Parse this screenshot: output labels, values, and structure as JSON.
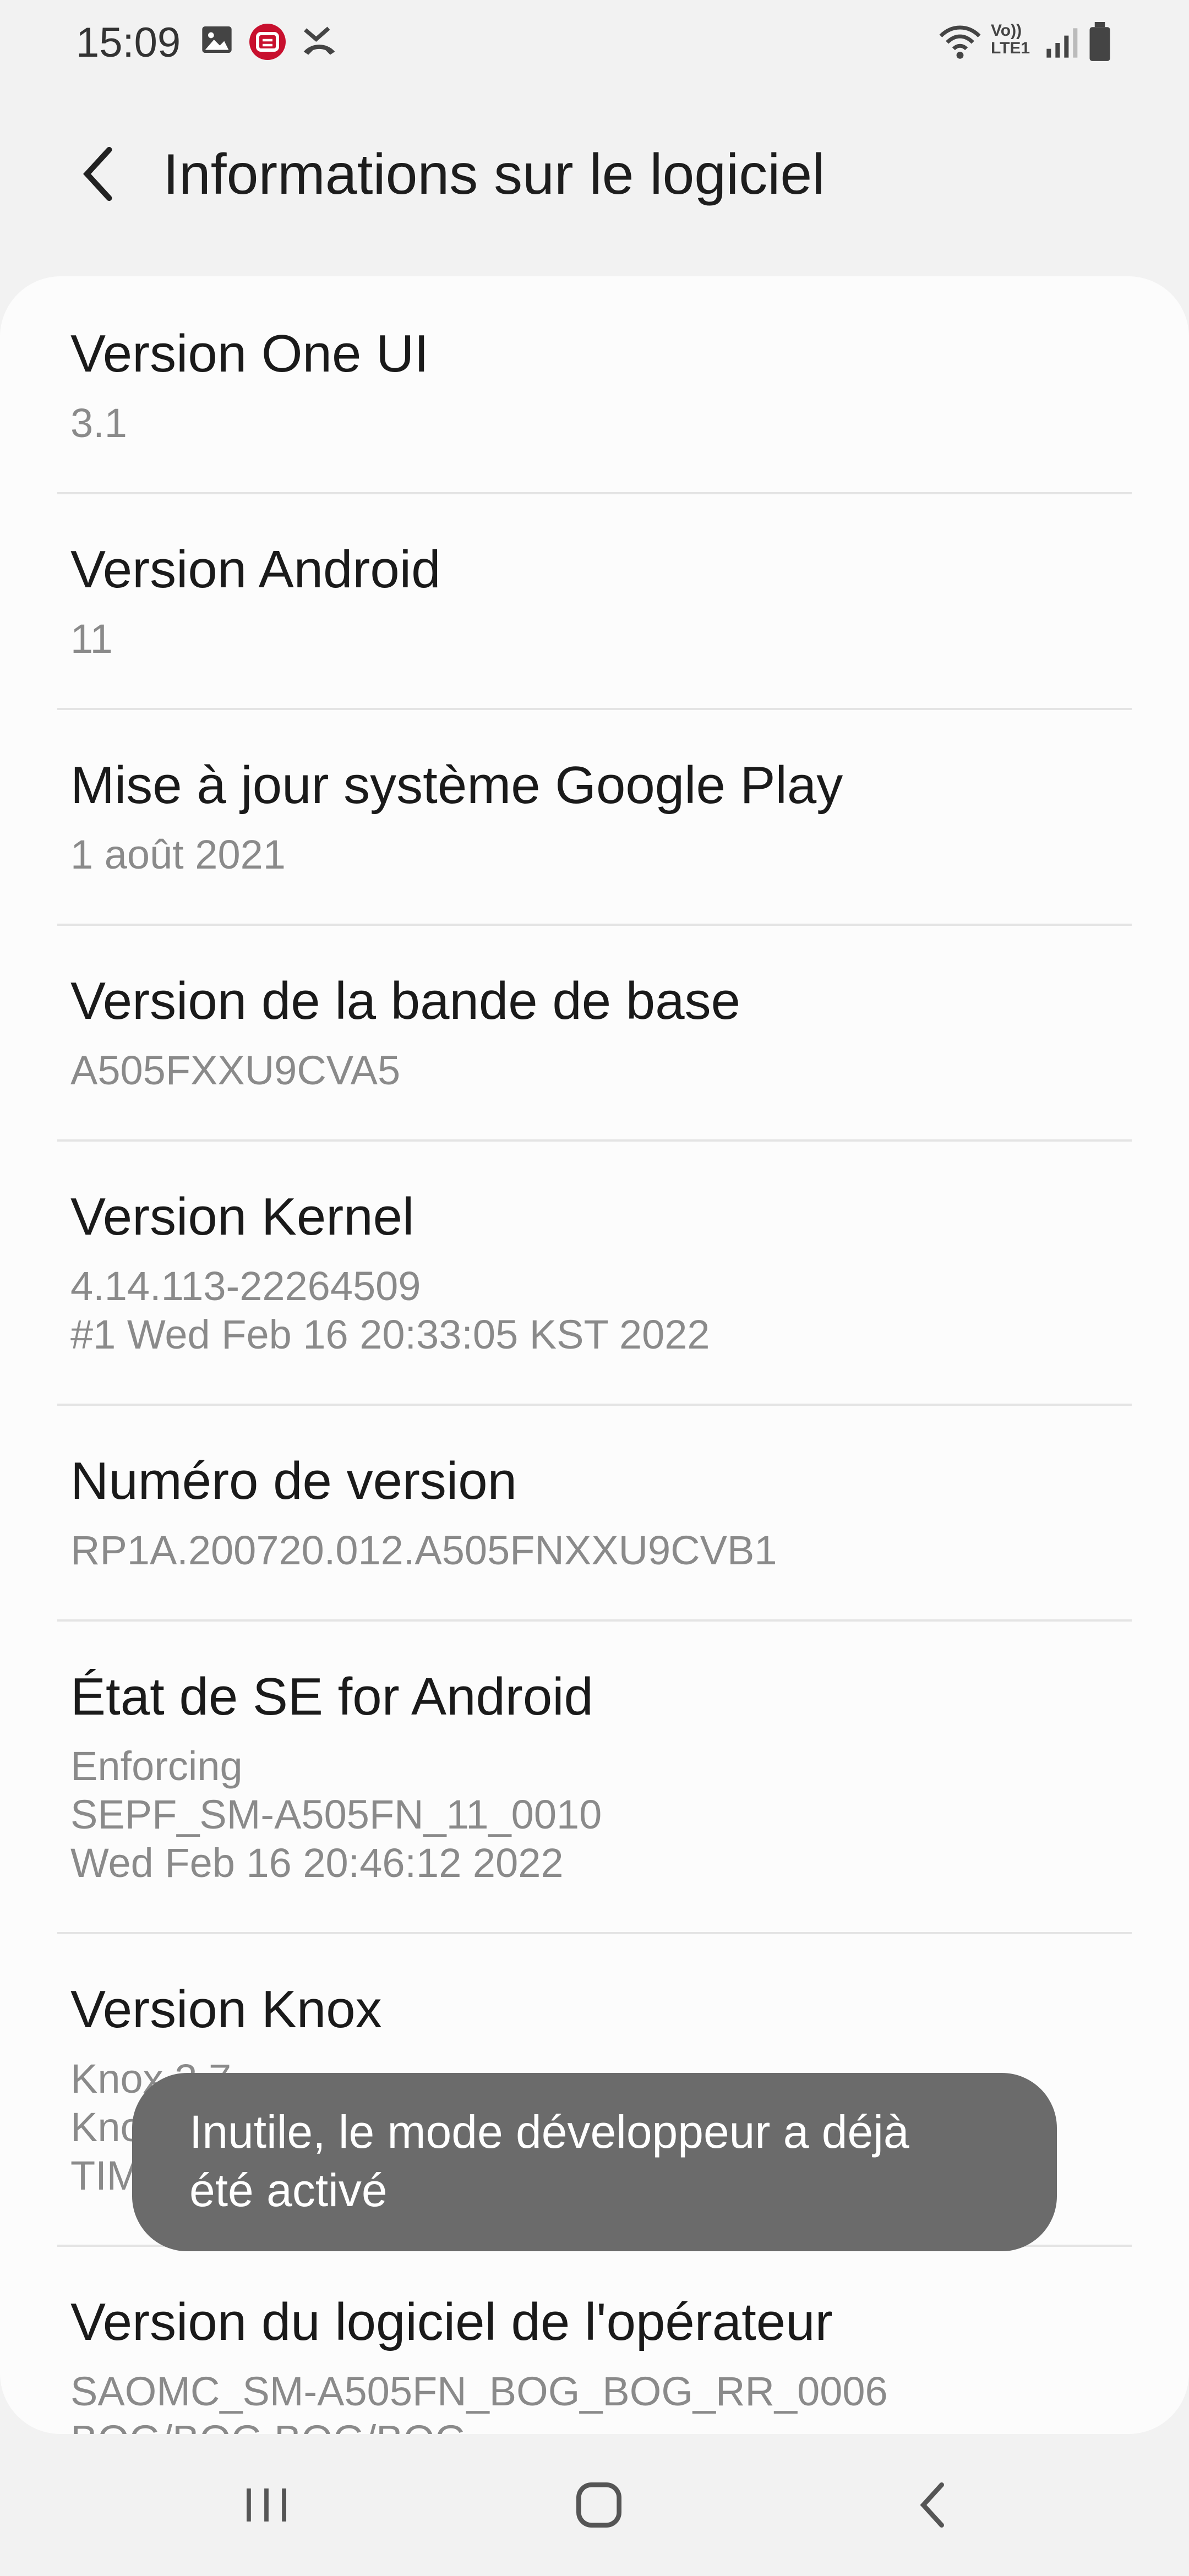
{
  "status_bar": {
    "time": "15:09",
    "left_icons": [
      "gallery-icon",
      "app-notification-icon",
      "missed-call-icon"
    ],
    "right_icons": [
      "wifi-icon",
      "volte-lte-icon",
      "signal-icon",
      "battery-icon"
    ],
    "volte_label": "Vo)) LTE1"
  },
  "header": {
    "title": "Informations sur le logiciel"
  },
  "items": [
    {
      "title": "Version One UI",
      "lines": [
        "3.1"
      ]
    },
    {
      "title": "Version Android",
      "lines": [
        "11"
      ]
    },
    {
      "title": "Mise à jour système Google Play",
      "lines": [
        "1 août 2021"
      ]
    },
    {
      "title": "Version de la bande de base",
      "lines": [
        "A505FXXU9CVA5"
      ]
    },
    {
      "title": "Version Kernel",
      "lines": [
        "4.14.113-22264509",
        "#1 Wed Feb 16 20:33:05 KST 2022"
      ]
    },
    {
      "title": "Numéro de version",
      "lines": [
        "RP1A.200720.012.A505FNXXU9CVB1"
      ]
    },
    {
      "title": "État de SE for Android",
      "lines": [
        "Enforcing",
        "SEPF_SM-A505FN_11_0010",
        "Wed Feb 16 20:46:12 2022"
      ]
    },
    {
      "title": "Version Knox",
      "lines": [
        "Knox 3.7",
        "Knox A",
        "TIMA"
      ]
    },
    {
      "title": "Version du logiciel de l'opérateur",
      "lines": [
        "SAOMC_SM-A505FN_BOG_BOG_RR_0006",
        "BOG/BOG,BOG/BOG"
      ]
    }
  ],
  "toast": {
    "lines": [
      "Inutile, le mode développeur a déjà",
      "été activé"
    ]
  },
  "nav_bar": {
    "buttons": [
      "recent-apps-icon",
      "home-icon",
      "back-icon"
    ]
  }
}
